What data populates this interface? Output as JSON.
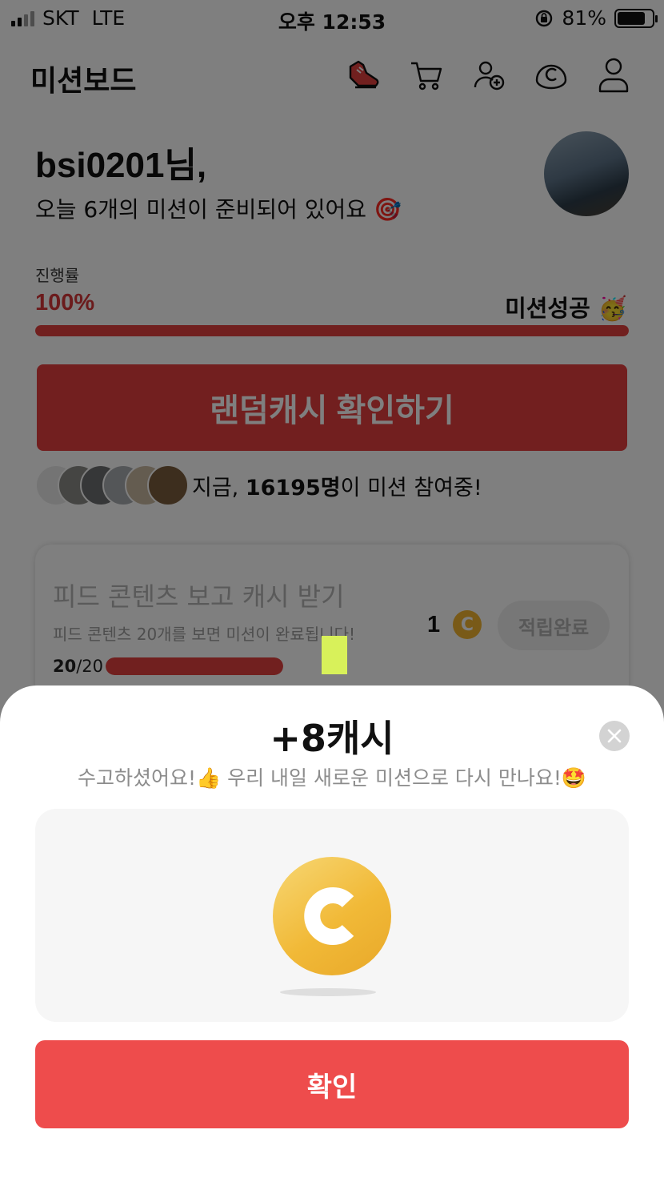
{
  "status_bar": {
    "carrier": "SKT",
    "network": "LTE",
    "time": "오후 12:53",
    "battery": "81%",
    "battery_level": 0.81
  },
  "header": {
    "title": "미션보드",
    "icons": [
      "shoe-icon",
      "cart-icon",
      "add-friend-icon",
      "cash-coin-icon",
      "profile-icon"
    ]
  },
  "greeting": {
    "name": "bsi0201님,",
    "message": "오늘 6개의 미션이 준비되어 있어요 🎯"
  },
  "progress": {
    "label": "진행률",
    "percent_text": "100%",
    "percent": 100,
    "status_text": "미션성공 🥳",
    "bar_color": "#e2403f"
  },
  "random_cash_button": "랜덤캐시 확인하기",
  "participants": {
    "prefix": "지금, ",
    "count": "16195명",
    "suffix": "이 미션 참여중!"
  },
  "mission": {
    "title": "피드 콘텐츠 보고 캐시 받기",
    "description": "피드 콘텐츠 20개를 보면 미션이 완료됩니다!",
    "progress_current": "20",
    "progress_total": "/20",
    "progress_ratio": 1.0,
    "reward": "1",
    "status_button": "적립완료"
  },
  "popup": {
    "title": "+8캐시",
    "subtitle": "수고하셨어요!👍 우리 내일 새로운 미션으로 다시 만나요!🤩",
    "confirm_button": "확인"
  },
  "colors": {
    "accent": "#e2403f",
    "button": "#ee4c4c",
    "coin": "#f1b937"
  }
}
